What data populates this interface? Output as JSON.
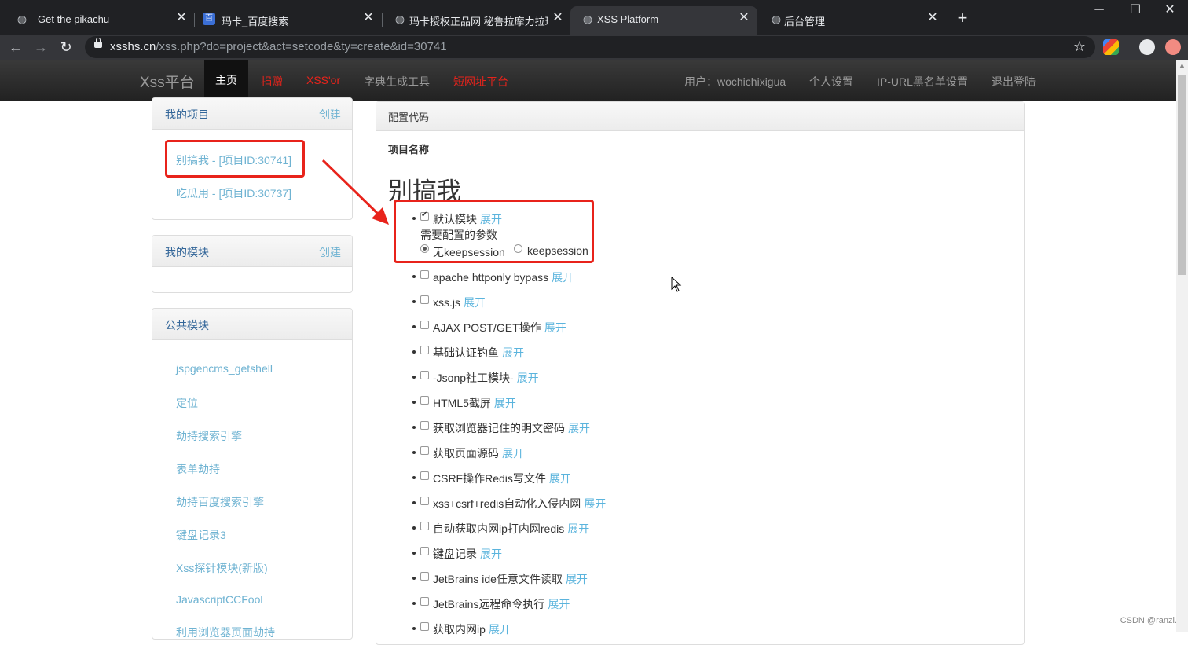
{
  "browser": {
    "tabs": [
      {
        "title": "Get the pikachu",
        "icon": "globe-icon"
      },
      {
        "title": "玛卡_百度搜索",
        "icon": "baidu-icon"
      },
      {
        "title": "玛卡授权正品网 秘鲁拉摩力拉玛",
        "icon": "globe-icon"
      },
      {
        "title": "XSS Platform",
        "icon": "globe-icon"
      },
      {
        "title": "后台管理",
        "icon": "globe-icon"
      }
    ],
    "url_host": "xsshs.cn",
    "url_path": "/xss.php?do=project&act=setcode&ty=create&id=30741"
  },
  "nav": {
    "brand": "Xss平台",
    "items": [
      "主页",
      "捐赠",
      "XSS'or",
      "字典生成工具",
      "短网址平台"
    ],
    "user": "用户：wochichixigua",
    "settings": "个人设置",
    "blacklist": "IP-URL黑名单设置",
    "logout": "退出登陆"
  },
  "sidebar": {
    "my_projects": {
      "title": "我的项目",
      "create": "创建",
      "items": [
        "别搞我 - [项目ID:30741]",
        "吃瓜用 - [项目ID:30737]"
      ]
    },
    "my_modules": {
      "title": "我的模块",
      "create": "创建"
    },
    "public_modules": {
      "title": "公共模块",
      "items": [
        "jspgencms_getshell",
        "定位",
        "劫持搜索引擎",
        "表单劫持",
        "劫持百度搜索引擎",
        "键盘记录3",
        "Xss探针模块(新版)",
        "JavascriptCCFool",
        "利用浏览器页面劫持"
      ]
    }
  },
  "main": {
    "header": "配置代码",
    "project_label": "项目名称",
    "project_name": "别搞我",
    "expand": "展开",
    "default_module": {
      "label": "默认模块",
      "checked": true,
      "params_label": "需要配置的参数",
      "options": [
        "无keepsession",
        "keepsession"
      ],
      "selected": 0
    },
    "modules": [
      "apache httponly bypass",
      "xss.js",
      "AJAX POST/GET操作",
      "基础认证钓鱼",
      "-Jsonp社工模块-",
      "HTML5截屏",
      "获取浏览器记住的明文密码",
      "获取页面源码",
      "CSRF操作Redis写文件",
      "xss+csrf+redis自动化入侵内网",
      "自动获取内网ip打内网redis",
      "键盘记录",
      "JetBrains ide任意文件读取",
      "JetBrains远程命令执行",
      "获取内网ip"
    ]
  },
  "watermark": "CSDN @ranzi.",
  "colors": {
    "annotation_red": "#e8231b",
    "link_blue": "#6fb3d2",
    "nav_dark": "#222222"
  }
}
